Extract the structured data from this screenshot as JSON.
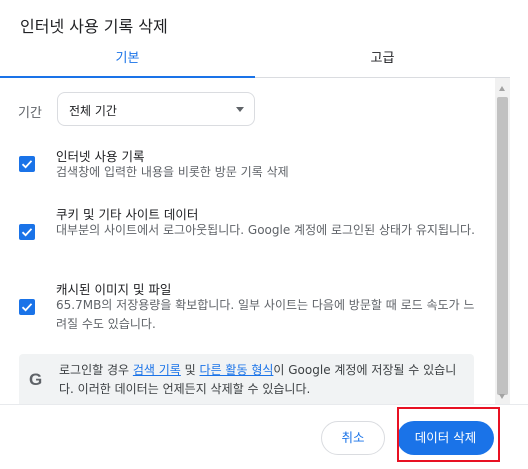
{
  "dialog": {
    "title": "인터넷 사용 기록 삭제"
  },
  "tabs": [
    {
      "label": "기본",
      "selected": true
    },
    {
      "label": "고급",
      "selected": false
    }
  ],
  "period": {
    "label": "기간",
    "value": "전체 기간"
  },
  "items": [
    {
      "title": "인터넷 사용 기록",
      "desc": "검색창에 입력한 내용을 비롯한 방문 기록 삭제",
      "checked": true
    },
    {
      "title": "쿠키 및 기타 사이트 데이터",
      "desc": "대부분의 사이트에서 로그아웃됩니다. Google 계정에 로그인된 상태가 유지됩니다.",
      "checked": true
    },
    {
      "title": "캐시된 이미지 및 파일",
      "desc": "65.7MB의 저장용량을 확보합니다. 일부 사이트는 다음에 방문할 때 로드 속도가 느려질 수도 있습니다.",
      "checked": true
    }
  ],
  "notice": {
    "icon": "google-g-icon",
    "prefix": "로그인할 경우 ",
    "link1": "검색 기록",
    "mid": " 및 ",
    "link2": "다른 활동 형식",
    "suffix": "이 Google 계정에 저장될 수 있습니다. 이러한 데이터는 언제든지 삭제할 수 있습니다."
  },
  "buttons": {
    "cancel": "취소",
    "delete": "데이터 삭제"
  },
  "colors": {
    "accent": "#1a73e8",
    "highlight": "#e81123"
  }
}
